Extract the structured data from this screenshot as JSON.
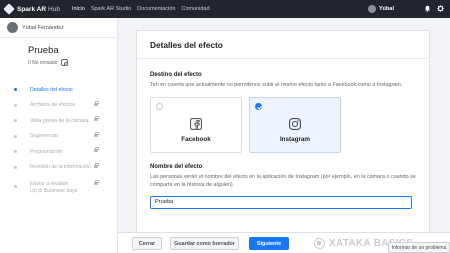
{
  "topbar": {
    "brand": "Spark AR",
    "brand_sub": "Hub",
    "nav": [
      "Inicio",
      "Spark AR Studio",
      "Documentación",
      "Comunidad"
    ],
    "user": "Yúbal",
    "icons": [
      "bell-icon",
      "gear-icon"
    ]
  },
  "sidebar": {
    "user_name": "Yúbal Fernández",
    "project_title": "Prueba",
    "project_status": "0 No enviado",
    "steps": [
      {
        "label": "Detalles del efecto",
        "active": true,
        "locked": false
      },
      {
        "label": "Archivos de efectos",
        "active": false,
        "locked": true
      },
      {
        "label": "Vista previa de la cámara",
        "active": false,
        "locked": true
      },
      {
        "label": "Sugerencias",
        "active": false,
        "locked": true
      },
      {
        "label": "Programación",
        "active": false,
        "locked": true
      },
      {
        "label": "Revisión de la información",
        "active": false,
        "locked": true
      },
      {
        "label": "Enviar a revisión",
        "sublabel": "Up to Business days",
        "active": false,
        "locked": true
      }
    ]
  },
  "main": {
    "header": "Detalles del efecto",
    "destination": {
      "title": "Destino del efecto",
      "description": "Ten en cuenta que actualmente no permitimos subir el mismo efecto tanto a Facebook como a Instagram.",
      "options": [
        {
          "label": "Facebook",
          "selected": false,
          "icon": "facebook-icon"
        },
        {
          "label": "Instagram",
          "selected": true,
          "icon": "instagram-icon"
        }
      ]
    },
    "name": {
      "title": "Nombre del efecto",
      "description": "Las personas verán el nombre del efecto en la aplicación de Instagram (por ejemplo, en la cámara o cuando se comparta en la historia de alguien).",
      "value": "Prueba"
    }
  },
  "footer": {
    "cancel": "Cerrar",
    "draft": "Guardar como borrador",
    "next": "Siguiente",
    "report": "Informar de un problema"
  },
  "watermark": "XATAKA BASICS",
  "colors": {
    "accent": "#1877f2",
    "topbar": "#22262c"
  }
}
